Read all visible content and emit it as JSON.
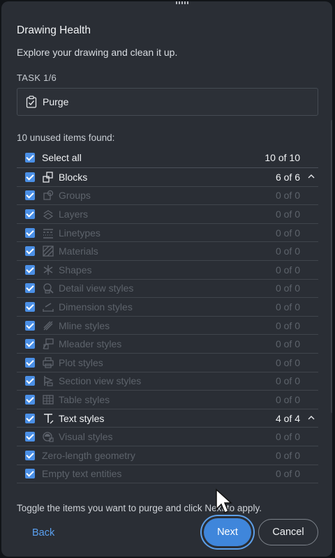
{
  "dialog": {
    "title": "Drawing Health",
    "subtitle": "Explore your drawing and clean it up.",
    "task_label": "TASK 1/6",
    "task_name": "Purge",
    "found_text": "10 unused items found:",
    "select_all": {
      "label": "Select all",
      "count": "10 of 10",
      "checked": true
    },
    "items": [
      {
        "label": "Blocks",
        "count": "6 of 6",
        "icon": "blocks-icon",
        "active": true,
        "expandable": true
      },
      {
        "label": "Groups",
        "count": "0 of 0",
        "icon": "groups-icon",
        "active": false
      },
      {
        "label": "Layers",
        "count": "0 of 0",
        "icon": "layers-icon",
        "active": false
      },
      {
        "label": "Linetypes",
        "count": "0 of 0",
        "icon": "linetypes-icon",
        "active": false
      },
      {
        "label": "Materials",
        "count": "0 of 0",
        "icon": "materials-icon",
        "active": false
      },
      {
        "label": "Shapes",
        "count": "0 of 0",
        "icon": "shapes-icon",
        "active": false
      },
      {
        "label": "Detail view styles",
        "count": "0 of 0",
        "icon": "detail-view-styles-icon",
        "active": false
      },
      {
        "label": "Dimension styles",
        "count": "0 of 0",
        "icon": "dimension-styles-icon",
        "active": false
      },
      {
        "label": "Mline styles",
        "count": "0 of 0",
        "icon": "mline-styles-icon",
        "active": false
      },
      {
        "label": "Mleader styles",
        "count": "0 of 0",
        "icon": "mleader-styles-icon",
        "active": false
      },
      {
        "label": "Plot styles",
        "count": "0 of 0",
        "icon": "plot-styles-icon",
        "active": false
      },
      {
        "label": "Section view styles",
        "count": "0 of 0",
        "icon": "section-view-styles-icon",
        "active": false
      },
      {
        "label": "Table styles",
        "count": "0 of 0",
        "icon": "table-styles-icon",
        "active": false
      },
      {
        "label": "Text styles",
        "count": "4 of 4",
        "icon": "text-styles-icon",
        "active": true,
        "expandable": true
      },
      {
        "label": "Visual styles",
        "count": "0 of 0",
        "icon": "visual-styles-icon",
        "active": false
      },
      {
        "label": "Zero-length geometry",
        "count": "0 of 0",
        "icon": "",
        "active": false
      },
      {
        "label": "Empty text entities",
        "count": "0 of 0",
        "icon": "",
        "active": false
      }
    ],
    "footer_text": "Toggle the items you want to purge and click Next to apply.",
    "buttons": {
      "back": "Back",
      "next": "Next",
      "cancel": "Cancel"
    }
  },
  "colors": {
    "panel": "#2a2e35",
    "accent": "#4a8fe6",
    "link": "#5aa0f0"
  }
}
